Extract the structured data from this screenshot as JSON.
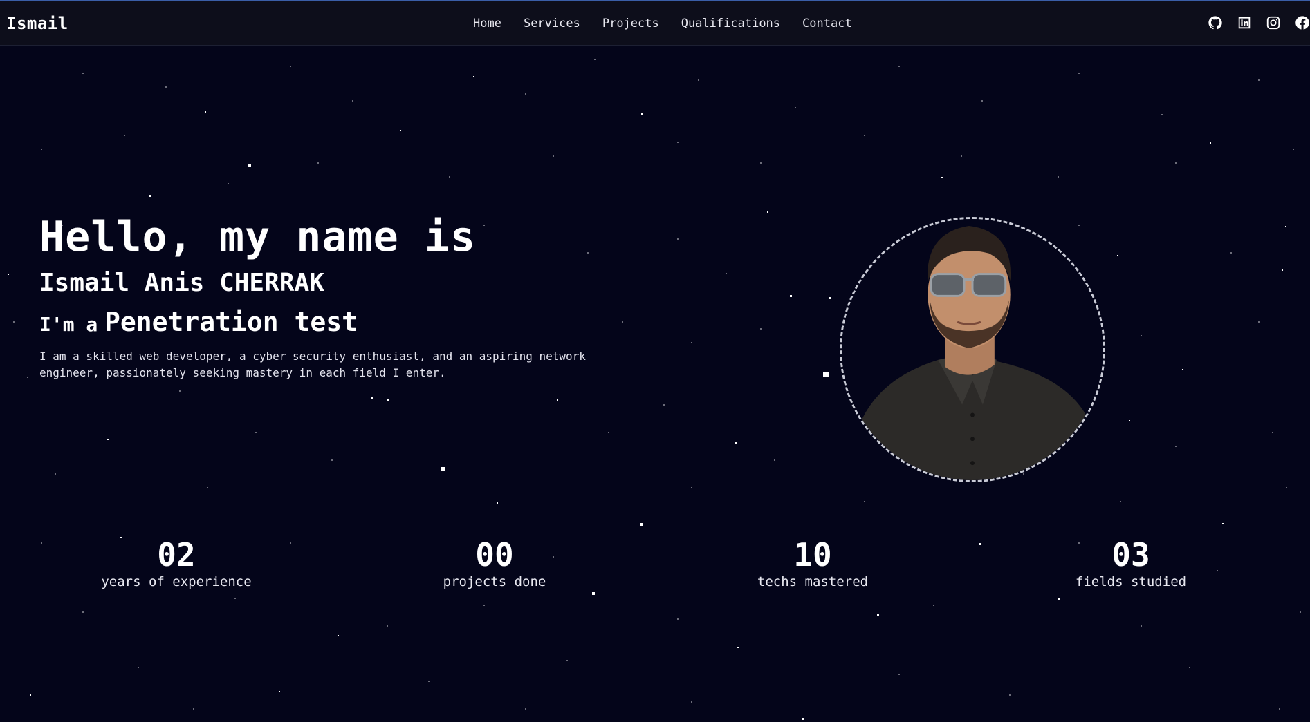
{
  "nav": {
    "brand": "Ismail",
    "links": [
      "Home",
      "Services",
      "Projects",
      "Qualifications",
      "Contact"
    ],
    "socials": [
      "github-icon",
      "linkedin-icon",
      "instagram-icon",
      "facebook-icon"
    ]
  },
  "hero": {
    "greeting": "Hello, my name is",
    "name": "Ismail Anis CHERRAK",
    "role_prefix": "I'm a",
    "role": "Penetration test",
    "about": "I am a skilled web developer, a cyber security enthusiast, and an aspiring network engineer, passionately seeking mastery in each field I enter."
  },
  "stats": [
    {
      "number": "02",
      "label": "years of experience"
    },
    {
      "number": "00",
      "label": "projects done"
    },
    {
      "number": "10",
      "label": "techs mastered"
    },
    {
      "number": "03",
      "label": "fields studied"
    }
  ],
  "colors": {
    "background": "#04051a",
    "navbar": "#0d0e1b",
    "accent": "#3a5ea8",
    "text": "#ffffff"
  }
}
